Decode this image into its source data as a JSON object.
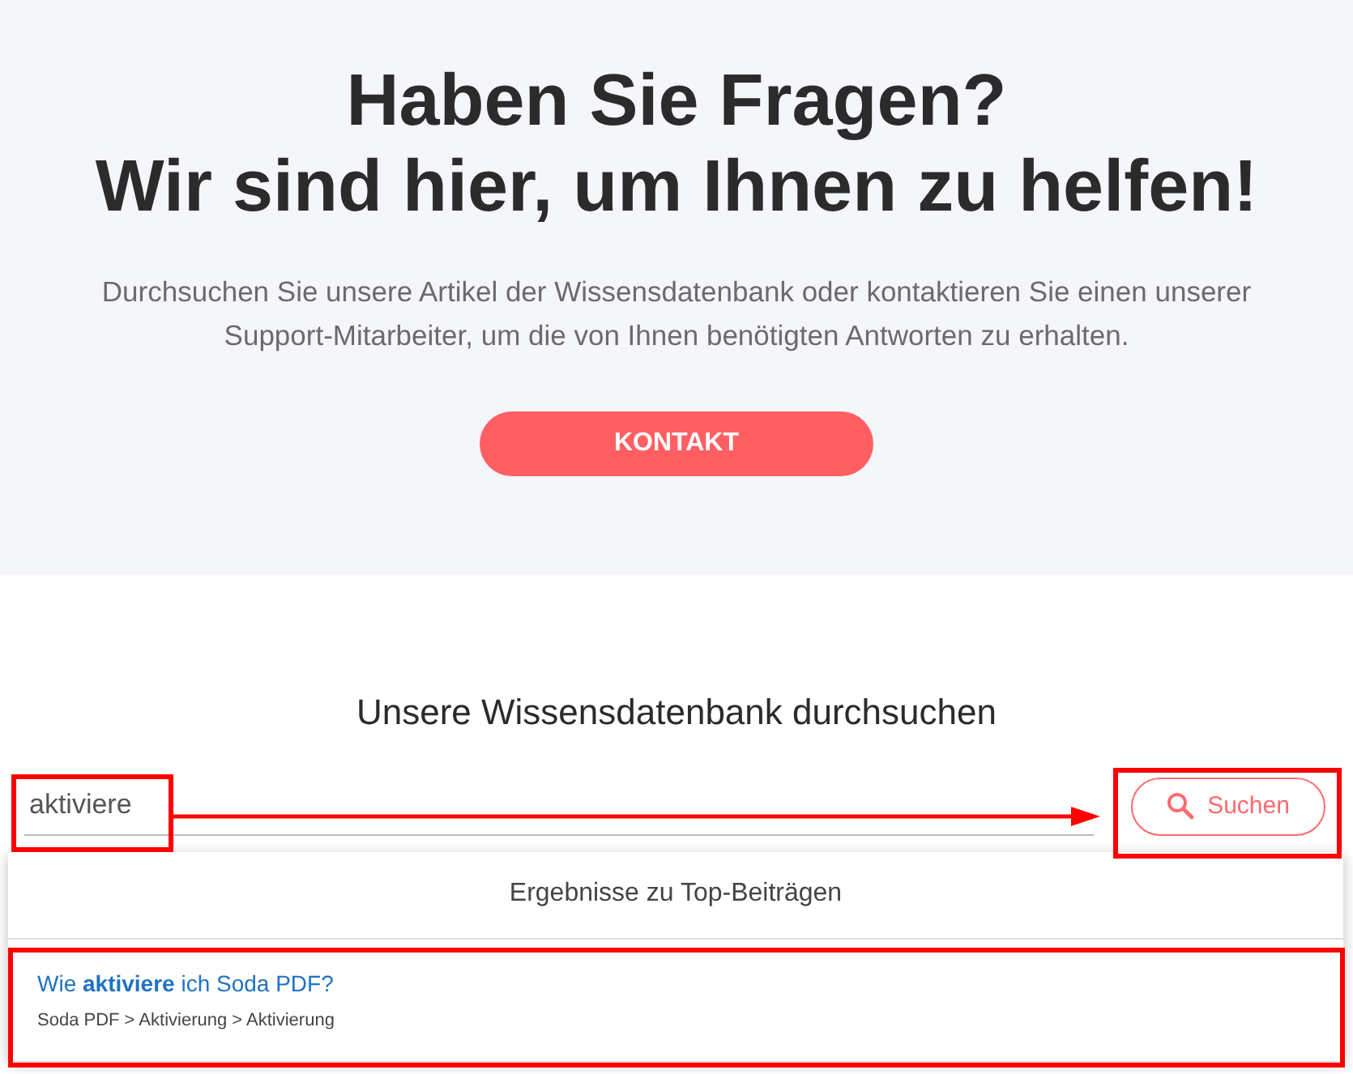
{
  "hero": {
    "title_lines": [
      "Haben Sie Fragen?",
      "Wir sind hier, um Ihnen zu helfen!"
    ],
    "description": "Durchsuchen Sie unsere Artikel der Wissensdatenbank oder kontaktieren Sie einen unserer Support-Mitarbeiter, um die von Ihnen benötigten Antworten zu erhalten.",
    "button": "KONTAKT"
  },
  "search": {
    "heading": "Unsere Wissensdatenbank durchsuchen",
    "value": "aktiviere",
    "button": "Suchen",
    "dropdown": {
      "header": "Ergebnisse zu Top-Beiträgen",
      "results": [
        {
          "title": "Wie **aktiviere** ich Soda PDF?",
          "breadcrumb": "Soda PDF > Aktivierung > Aktivierung"
        }
      ]
    }
  }
}
